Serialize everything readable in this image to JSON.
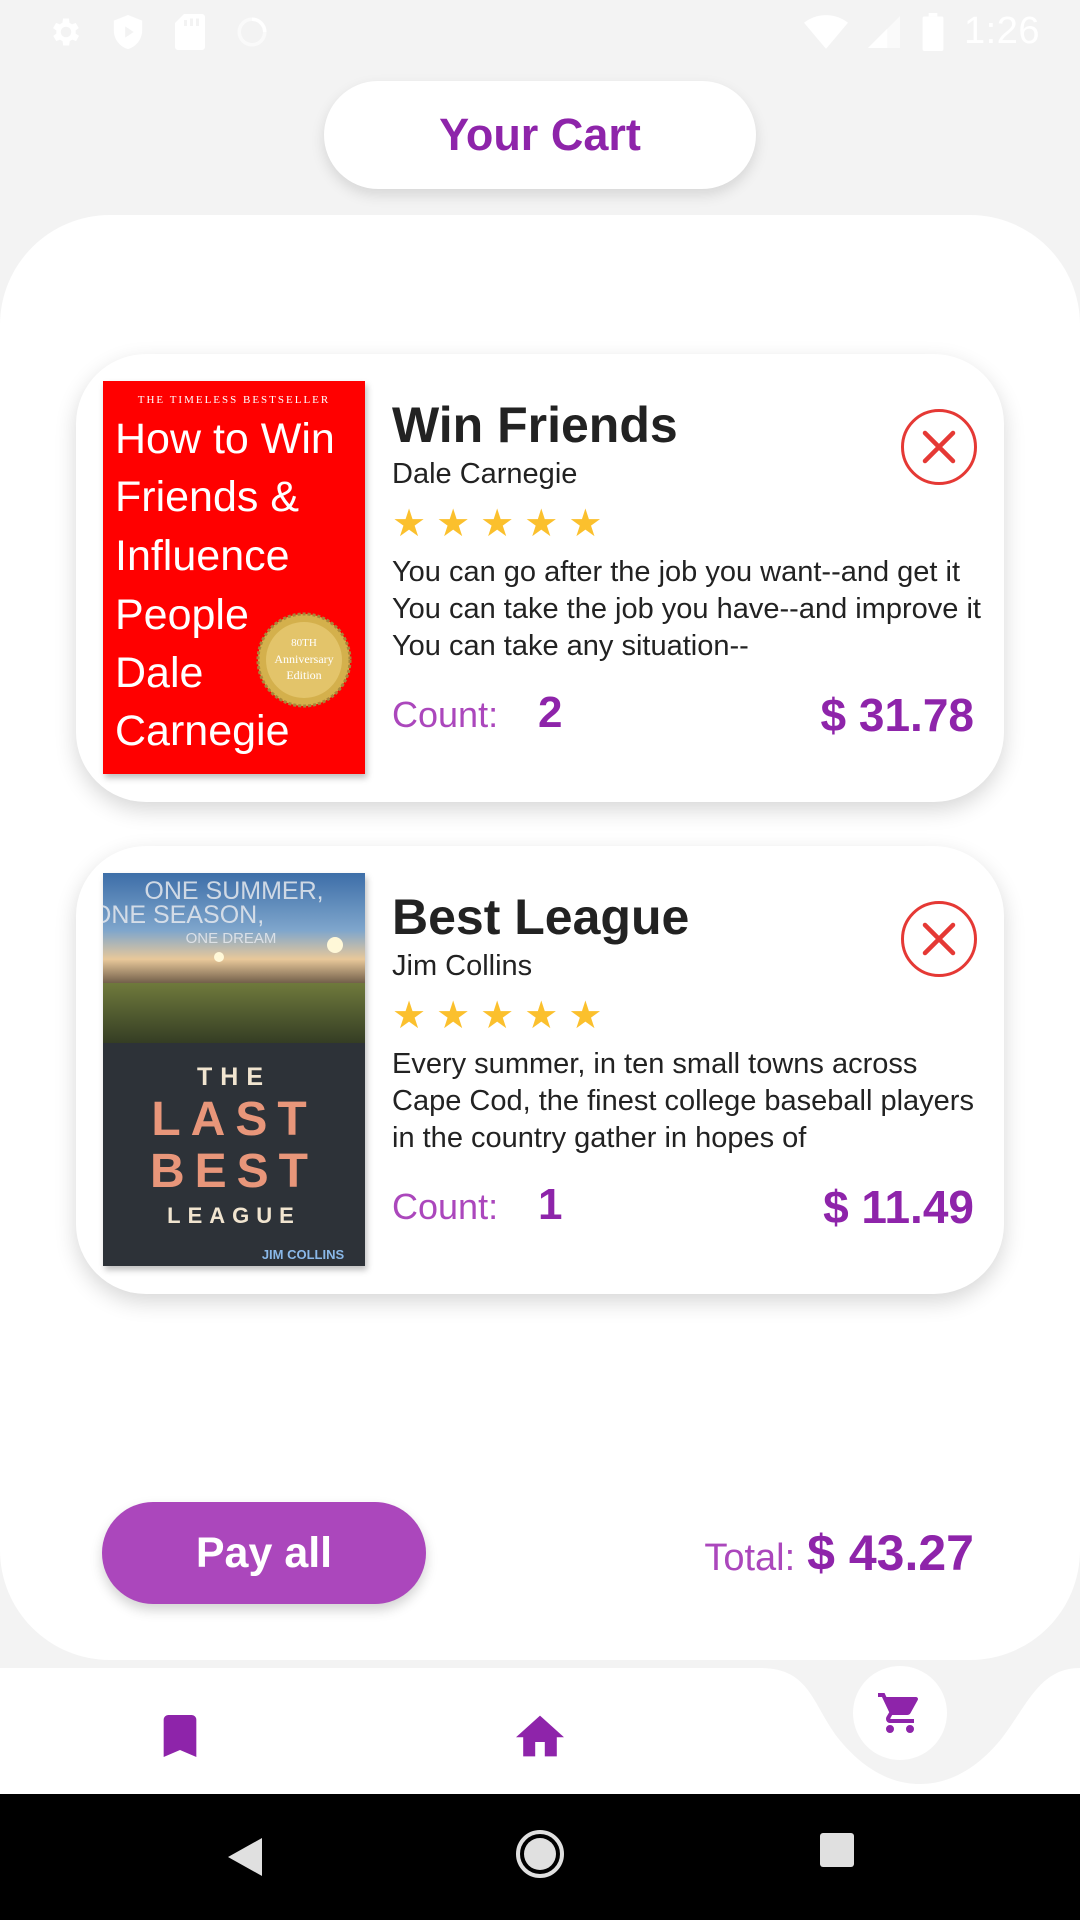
{
  "status_bar": {
    "time": "1:26",
    "left_icons": [
      "settings-icon",
      "shield-icon",
      "sd-card-icon",
      "sync-icon"
    ],
    "right_icons": [
      "wifi-icon",
      "signal-icon",
      "battery-icon"
    ]
  },
  "header": {
    "title": "Your Cart"
  },
  "cart": {
    "items": [
      {
        "title": "Win Friends",
        "author": "Dale Carnegie",
        "rating": 5,
        "stars": "★★★★★",
        "description": "You can go after the job you want--and get it You can take the job you have--and improve it You can take any situation--",
        "count_label": "Count:",
        "count": "2",
        "price": "$ 31.78",
        "cover": {
          "tagline": "THE TIMELESS BESTSELLER",
          "lines": [
            "How to Win",
            "Friends &",
            "Influence",
            "People",
            "Dale",
            "Carnegie"
          ],
          "seal_line1": "80TH",
          "seal_line2": "Anniversary",
          "seal_line3": "Edition",
          "background": "#ff0000"
        }
      },
      {
        "title": "Best League",
        "author": "Jim Collins",
        "rating": 5,
        "stars": "★★★★★",
        "description": "Every summer, in ten small towns across Cape Cod, the finest college baseball players in the country gather in hopes of",
        "count_label": "Count:",
        "count": "1",
        "price": "$ 11.49",
        "cover": {
          "top_line1": "ONE SUMMER,",
          "top_line2": "ONE SEASON,",
          "top_line3": "ONE DREAM",
          "word1": "THE",
          "word2": "LAST",
          "word3": "BEST",
          "word4": "LEAGUE",
          "author_line": "JIM COLLINS"
        }
      }
    ]
  },
  "footer": {
    "pay_label": "Pay all",
    "total_label": "Total:",
    "total_value": "$ 43.27"
  },
  "bottom_nav": {
    "items": [
      "bookmark-icon",
      "home-icon",
      "cart-icon"
    ],
    "active": "cart-icon"
  },
  "colors": {
    "accent": "#8e24aa",
    "accent_light": "#ab47bc",
    "star": "#fbc02d",
    "remove": "#e53935",
    "background": "#f3f3f3"
  }
}
